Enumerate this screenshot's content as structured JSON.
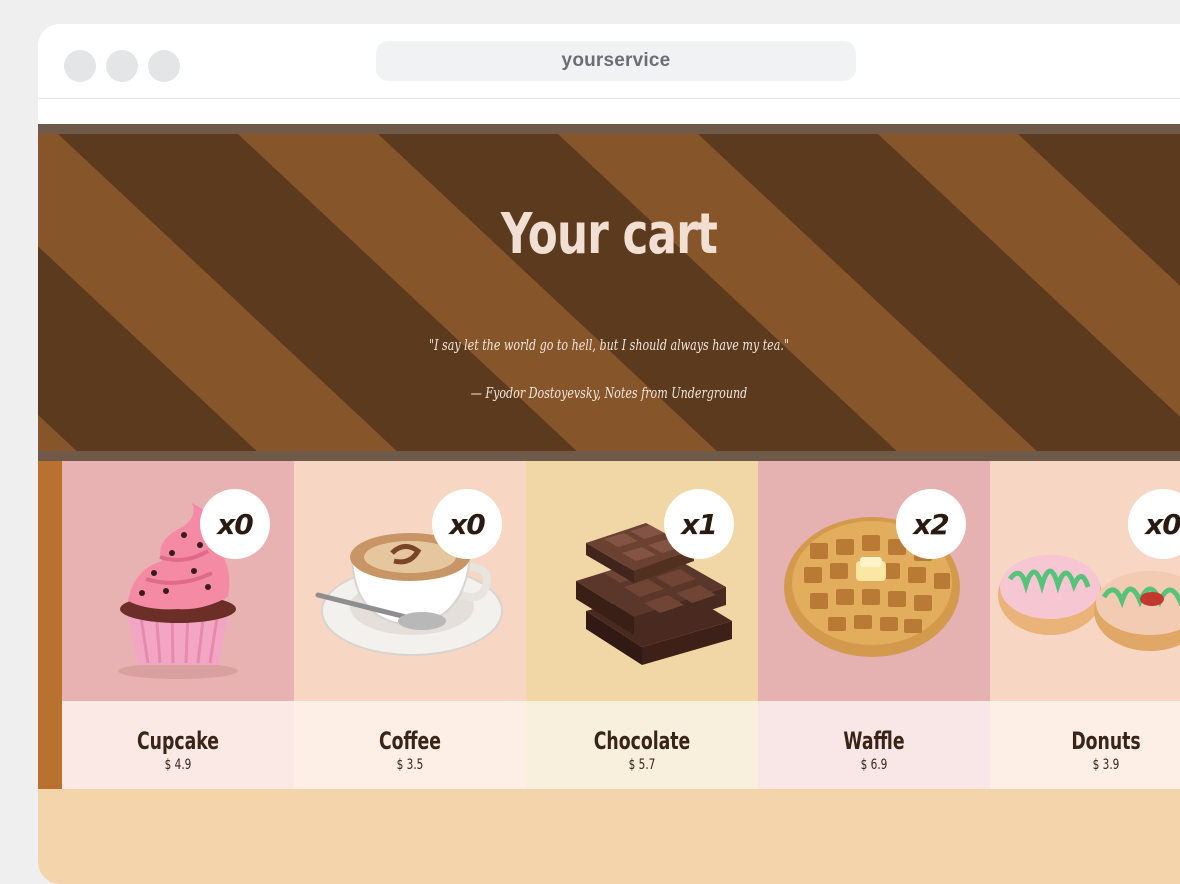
{
  "browser": {
    "url": "yourservice"
  },
  "hero": {
    "title": "Your cart",
    "quote": "\"I say let the world go to hell, but I should always have my tea.\"",
    "attribution": "— Fyodor Dostoyevsky, Notes from Underground"
  },
  "products": [
    {
      "name": "Cupcake",
      "price": "$ 4.9",
      "quantity": "x0",
      "icon": "cupcake-icon",
      "photo_bg": "#e8b2b2",
      "info_bg": "#fbe9e5"
    },
    {
      "name": "Coffee",
      "price": "$ 3.5",
      "quantity": "x0",
      "icon": "coffee-cup-icon",
      "photo_bg": "#f7d6c3",
      "info_bg": "#fdeee6"
    },
    {
      "name": "Chocolate",
      "price": "$ 5.7",
      "quantity": "x1",
      "icon": "chocolate-icon",
      "photo_bg": "#f1d6a6",
      "info_bg": "#f8efdc"
    },
    {
      "name": "Waffle",
      "price": "$ 6.9",
      "quantity": "x2",
      "icon": "waffle-icon",
      "photo_bg": "#e5b1b1",
      "info_bg": "#f9e6e6"
    },
    {
      "name": "Donuts",
      "price": "$ 3.9",
      "quantity": "x0",
      "icon": "donuts-icon",
      "photo_bg": "#f8d6c4",
      "info_bg": "#fdeee6"
    }
  ],
  "colors": {
    "stripe_dark": "#5c3a1e",
    "stripe_light": "#87552a",
    "title": "#f1dfd3",
    "footer": "#f4d4ab"
  }
}
